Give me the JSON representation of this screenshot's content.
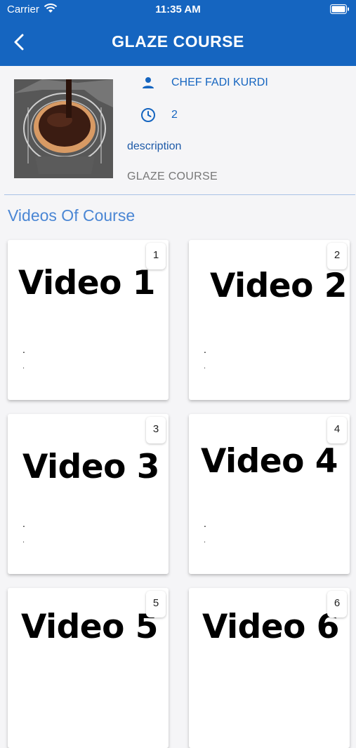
{
  "status_bar": {
    "carrier": "Carrier",
    "time": "11:35 AM"
  },
  "app_bar": {
    "title": "GLAZE COURSE"
  },
  "course": {
    "chef": "CHEF FADI KURDI",
    "duration": "2",
    "description_label": "description",
    "subtitle": "GLAZE COURSE"
  },
  "section_title": "Videos Of Course",
  "videos": [
    {
      "label": "Video 1",
      "number": "1",
      "line1": ".",
      "line2": "."
    },
    {
      "label": "Video 2",
      "number": "2",
      "line1": ".",
      "line2": "."
    },
    {
      "label": "Video 3",
      "number": "3",
      "line1": ".",
      "line2": "."
    },
    {
      "label": "Video 4",
      "number": "4",
      "line1": ".",
      "line2": "."
    },
    {
      "label": "Video 5",
      "number": "5",
      "line1": "",
      "line2": ""
    },
    {
      "label": "Video 6",
      "number": "6",
      "line1": "",
      "line2": ""
    }
  ],
  "colors": {
    "primary": "#1565c0",
    "section": "#4a86d4"
  }
}
